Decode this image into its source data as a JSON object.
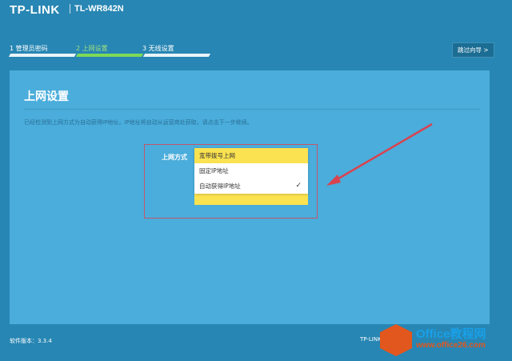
{
  "header": {
    "brand": "TP-LINK",
    "model": "TL-WR842N",
    "skip_label": "跳过向导 >"
  },
  "steps": [
    {
      "label": "1 管理员密码",
      "state": "done"
    },
    {
      "label": "2 上网设置",
      "state": "active"
    },
    {
      "label": "3 无线设置",
      "state": "pending"
    }
  ],
  "panel": {
    "title": "上网设置",
    "description": "已经检测到上网方式为自动获得IP地址，IP地址将自动从运营商处获取，请点击下一步继续。",
    "field_label": "上网方式",
    "options": [
      {
        "label": "宽带拨号上网",
        "highlighted": true,
        "checked": false
      },
      {
        "label": "固定IP地址",
        "highlighted": false,
        "checked": false
      },
      {
        "label": "自动获得IP地址",
        "highlighted": false,
        "checked": true
      }
    ]
  },
  "footer": {
    "version": "软件版本：3.3.4",
    "brand": "TP-LINK"
  },
  "watermark": {
    "text": "Office教程网",
    "url": "www.office26.com"
  },
  "colors": {
    "bg": "#2786b3",
    "panel": "#4aaddb",
    "accent": "#fbe250",
    "active_step": "#7ed957",
    "arrow": "#d9434f"
  }
}
